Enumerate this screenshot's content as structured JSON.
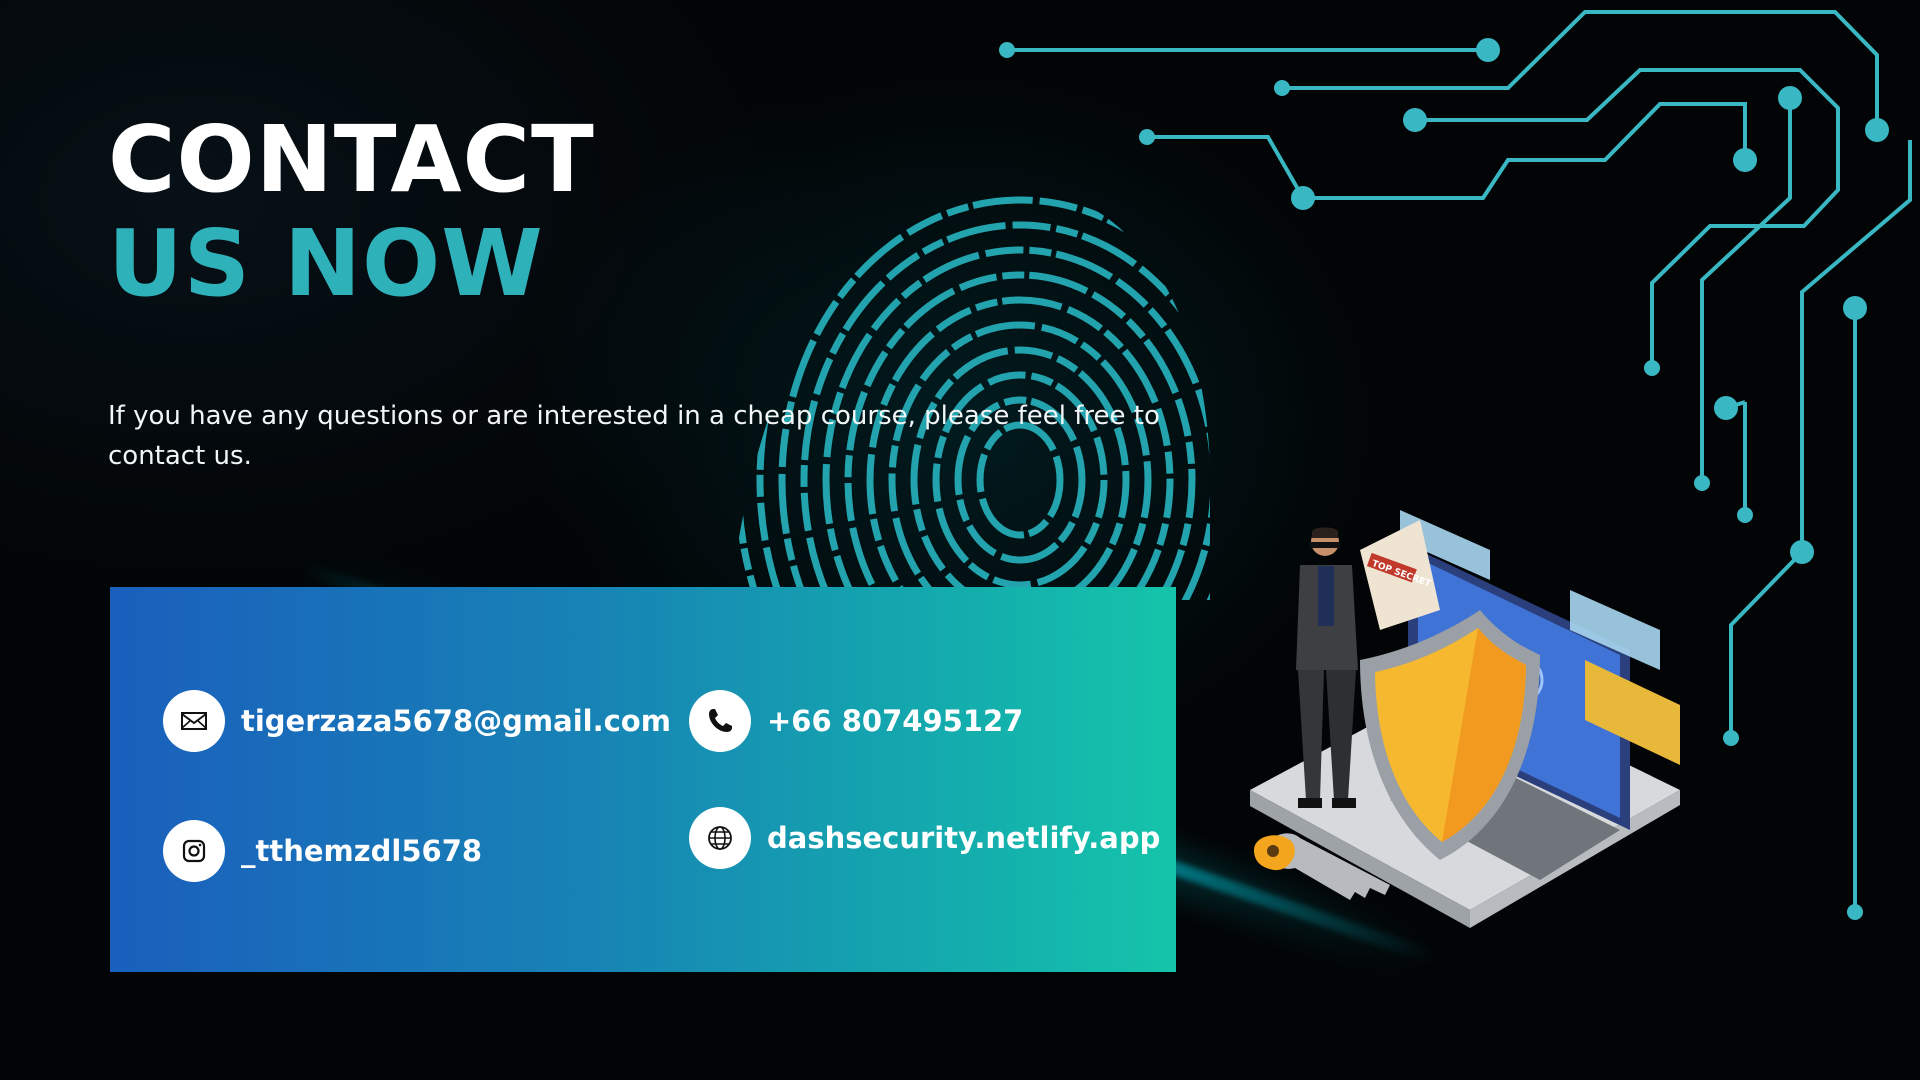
{
  "heading": {
    "line1": "CONTACT",
    "line2": "US NOW"
  },
  "intro_text": "If you have any questions or are interested in a cheap course, please feel free to contact us.",
  "contacts": {
    "email": "tigerzaza5678@gmail.com",
    "phone": "+66 807495127",
    "instagram": "_tthemzdl5678",
    "website": "dashsecurity.netlify.app"
  },
  "illustration": {
    "badge_text": "TOP SECRET"
  },
  "colors": {
    "accent_teal": "#2fb1ba",
    "circuit": "#39b7c2",
    "card_start": "#1a5fbd",
    "card_end": "#15c4aa",
    "background": "#020405"
  },
  "icons": [
    "mail-icon",
    "phone-icon",
    "instagram-icon",
    "globe-icon"
  ]
}
